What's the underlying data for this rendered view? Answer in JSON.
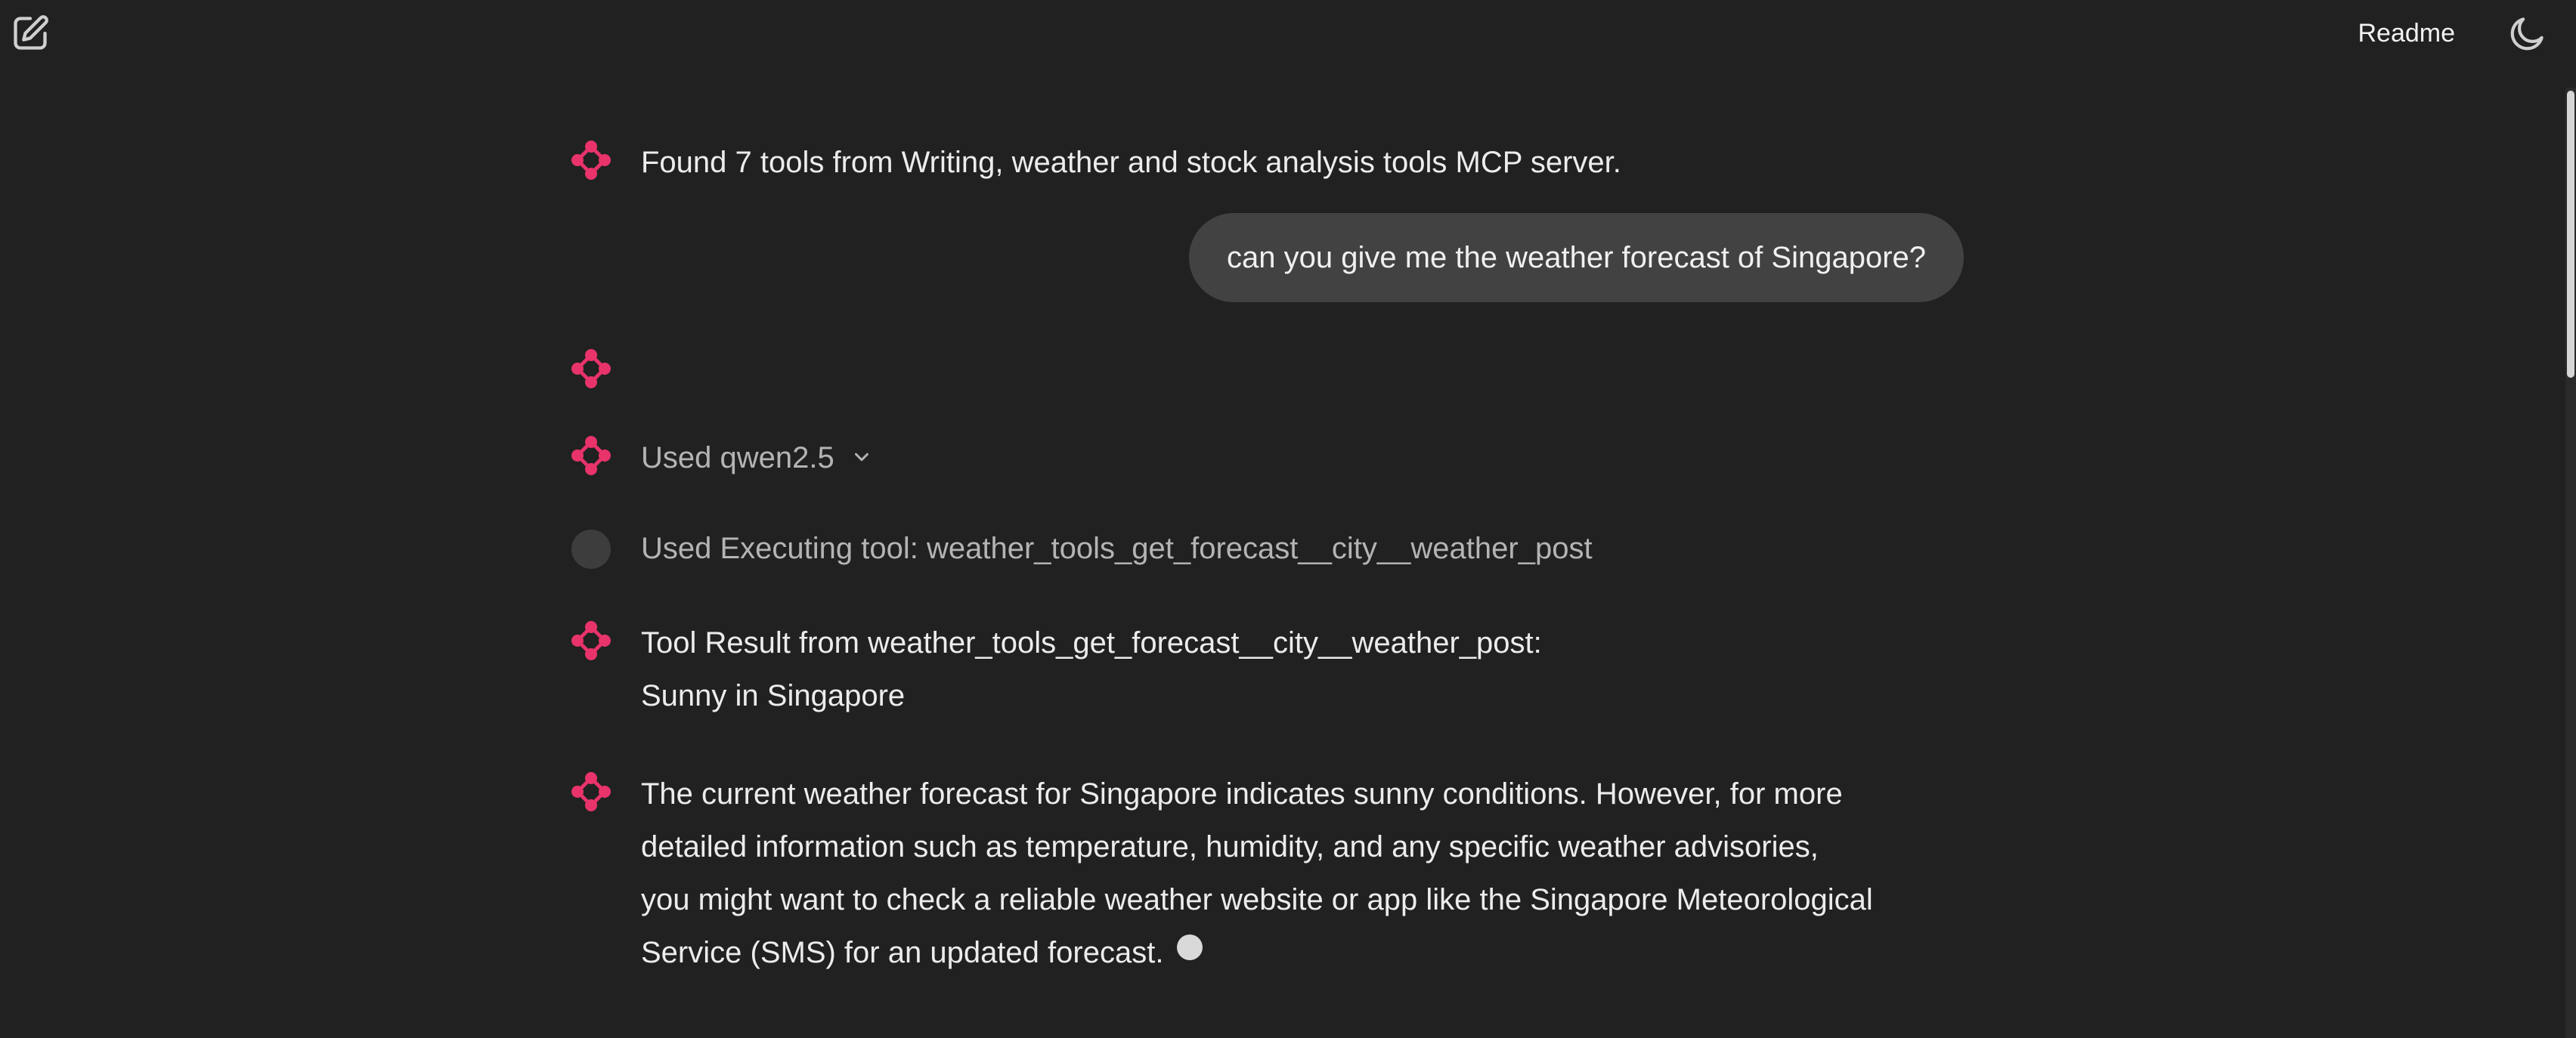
{
  "header": {
    "readme_label": "Readme"
  },
  "icons": {
    "new_chat": "edit-square-icon",
    "theme": "moon-icon",
    "assistant": "pink-flower-icon",
    "chevron": "chevron-down-icon"
  },
  "colors": {
    "background": "#212121",
    "accent": "#e8336b",
    "bubble": "#424242"
  },
  "messages": {
    "tools_found": "Found 7 tools from Writing, weather and stock analysis tools MCP server.",
    "user_question": "can you give me the weather forecast of Singapore?",
    "used_model": "Used qwen2.5",
    "executing_tool": "Used Executing tool: weather_tools_get_forecast__city__weather_post",
    "tool_result_line1": "Tool Result from weather_tools_get_forecast__city__weather_post:",
    "tool_result_line2": "Sunny in Singapore",
    "answer_line1": "The current weather forecast for Singapore indicates sunny conditions. However, for more",
    "answer_line2": "detailed information such as temperature, humidity, and any specific weather advisories,",
    "answer_line3": "you might want to check a reliable weather website or app like the Singapore Meteorological",
    "answer_line4": "Service (SMS) for an updated forecast."
  }
}
